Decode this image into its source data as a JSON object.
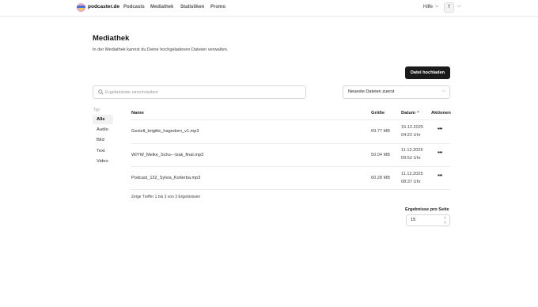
{
  "nav": {
    "brand": "podcaster.de",
    "links": [
      "Podcasts",
      "Mediathek",
      "Statistiken",
      "Promo"
    ],
    "help": "Hilfe",
    "avatar_initial": "f"
  },
  "page": {
    "title": "Mediathek",
    "description": "In der Mediathek kannst du Deine hochgeladenen Dateien verwalten.",
    "upload_button": "Datei hochladen"
  },
  "search": {
    "placeholder": "Ergebnisliste einschränken",
    "value": ""
  },
  "sort": {
    "selected": "Neueste Dateien zuerst"
  },
  "filter": {
    "heading": "Typ",
    "items": [
      "Alle",
      "Audio",
      "Bild",
      "Text",
      "Video"
    ],
    "active": "Alle"
  },
  "table": {
    "columns": [
      "Name",
      "Größe",
      "Datum",
      "Aktionen"
    ],
    "sort_indicator": "^",
    "action_icon": "more-horizontal-icon",
    "rows": [
      {
        "name": "Gezielt_brigitte_hagedorn_v1.mp3",
        "size": "69.77 MB",
        "date": "15.12.2025",
        "time": "04:22 Uhr"
      },
      {
        "name": "WIYW_Meike_Schu--‑lzak_final.mp3",
        "size": "50.04 MB",
        "date": "11.12.2025",
        "time": "09:52 Uhr"
      },
      {
        "name": "Podcast_132_Sylvia_Kotterba.mp3",
        "size": "60.28 MB",
        "date": "11.12.2025",
        "time": "08:37 Uhr"
      }
    ],
    "summary": "Zeige Treffer 1 bis 3 von 3 Ergebnissen"
  },
  "pagination": {
    "per_page_label": "Ergebnisse pro Seite",
    "per_page_value": "15"
  },
  "colors": {
    "primary_button": "#1a1a1a",
    "active_filter_bg": "#f1f1f1",
    "border": "#d8d8d8"
  }
}
